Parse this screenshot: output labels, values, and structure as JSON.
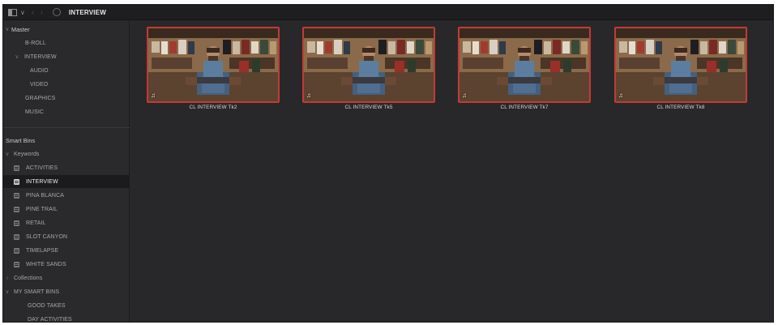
{
  "toolbar": {
    "title": "INTERVIEW",
    "icons": [
      "panel-toggle-icon",
      "chevron-down-icon",
      "back-arrow-icon",
      "forward-arrow-icon",
      "search-icon"
    ]
  },
  "sidebar": {
    "master": {
      "label": "Master",
      "items": [
        {
          "label": "B-ROLL"
        },
        {
          "label": "INTERVIEW",
          "children": [
            {
              "label": "AUDIO"
            },
            {
              "label": "VIDEO"
            }
          ]
        },
        {
          "label": "GRAPHICS"
        },
        {
          "label": "MUSIC"
        }
      ]
    },
    "smart_bins": {
      "label": "Smart Bins",
      "keywords": {
        "label": "Keywords",
        "items": [
          "ACTIVITIES",
          "INTERVIEW",
          "PINA BLANCA",
          "PINE TRAIL",
          "RETAIL",
          "SLOT CANYON",
          "TIMELAPSE",
          "WHITE SANDS"
        ],
        "selected": "INTERVIEW"
      },
      "collections": {
        "label": "Collections"
      },
      "my_smart_bins": {
        "label": "MY SMART BINS",
        "items": [
          "GOOD TAKES",
          "DAY ACTIVITIES"
        ]
      }
    }
  },
  "clips": [
    {
      "name": "CL INTERVIEW Tk2",
      "audio_icon": "♫"
    },
    {
      "name": "CL INTERVIEW Tk5",
      "audio_icon": "♫"
    },
    {
      "name": "CL INTERVIEW Tk7",
      "audio_icon": "♫"
    },
    {
      "name": "CL INTERVIEW Tk8",
      "audio_icon": "♫"
    }
  ],
  "colors": {
    "selection_border": "#c43a36",
    "panel_bg": "#28282a",
    "sidebar_bg": "#2a2a2c"
  }
}
